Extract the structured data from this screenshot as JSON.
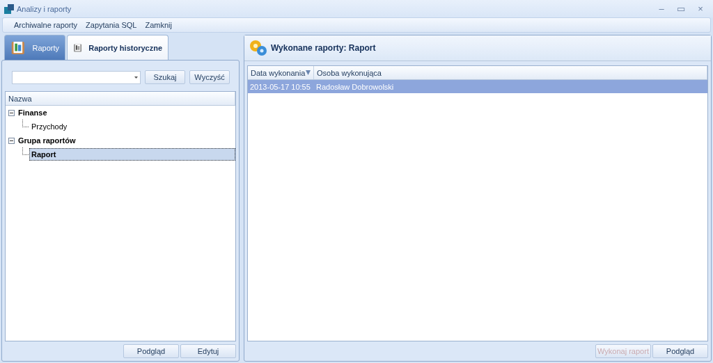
{
  "window": {
    "title": "Analizy i raporty",
    "controls": [
      "–",
      "▭",
      "×"
    ]
  },
  "menu": [
    "Archiwalne raporty",
    "Zapytania SQL",
    "Zamknij"
  ],
  "tabs": [
    {
      "label": "Raporty",
      "selected": true
    },
    {
      "label": "Raporty historyczne",
      "selected": false
    }
  ],
  "search": {
    "search_button": "Szukaj",
    "clear_button": "Wyczyść"
  },
  "tree": {
    "column": "Nazwa",
    "items": [
      {
        "label": "Finanse",
        "expanded": true,
        "selected": false,
        "children": [
          {
            "label": "Przychody",
            "selected": false
          }
        ]
      },
      {
        "label": "Grupa raportów",
        "expanded": true,
        "selected": false,
        "children": [
          {
            "label": "Raport",
            "selected": true
          }
        ]
      }
    ]
  },
  "left_buttons": [
    {
      "label": "Podgląd",
      "disabled": false
    },
    {
      "label": "Edytuj",
      "disabled": false
    }
  ],
  "right_panel": {
    "title": "Wykonane raporty: Raport",
    "table": {
      "columns": [
        {
          "label": "Data wykonania",
          "sorted": true
        },
        {
          "label": "Osoba wykonująca",
          "sorted": false
        }
      ],
      "rows": [
        {
          "cells": [
            "2013-05-17 10:55",
            "Radosław Dobrowolski"
          ],
          "selected": true
        }
      ]
    },
    "buttons": [
      {
        "label": "Wykonaj raport",
        "disabled": true
      },
      {
        "label": "Podgląd",
        "disabled": false
      }
    ]
  }
}
